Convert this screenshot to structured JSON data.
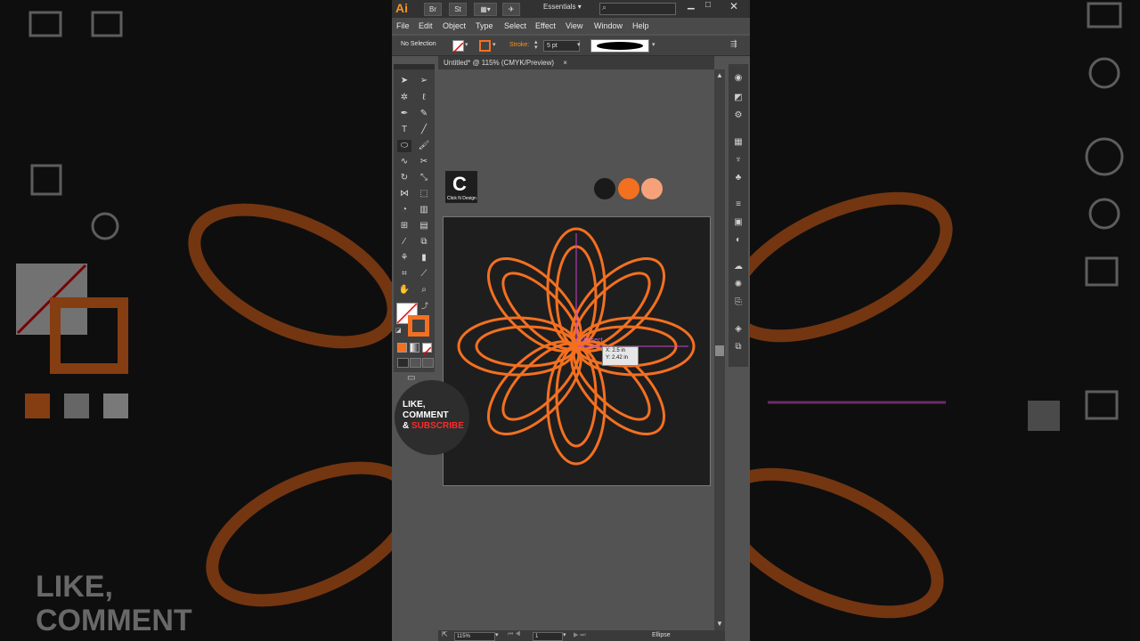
{
  "background": {
    "left_caption_line1": "LIKE,",
    "left_caption_line2": "COMMENT"
  },
  "titlebar": {
    "app_logo": "Ai",
    "br_label": "Br",
    "st_label": "St",
    "workspace": "Essentials",
    "search_placeholder": ""
  },
  "menu": {
    "items": [
      "File",
      "Edit",
      "Object",
      "Type",
      "Select",
      "Effect",
      "View",
      "Window",
      "Help"
    ]
  },
  "control_bar": {
    "selection": "No Selection",
    "stroke_label": "Stroke:",
    "stroke_weight": "5 pt"
  },
  "document_tab": {
    "title": "Untitled* @ 115% (CMYK/Preview)",
    "close": "×"
  },
  "logo": {
    "mark": "C",
    "caption": "Click N Design"
  },
  "swatches": {
    "colors": [
      "#1a1a1a",
      "#f37021",
      "#f5a27a"
    ]
  },
  "smart_guide": {
    "label": "intersect",
    "x": "X: 2.5 in",
    "y": "Y: 2.42 in"
  },
  "like_badge": {
    "line1": "LIKE,",
    "line2": "COMMENT",
    "line3_prefix": "& ",
    "line3_highlight": "SUBSCRIBE"
  },
  "status_bar": {
    "zoom": "115%",
    "page": "1",
    "tool": "Ellipse"
  },
  "colors": {
    "accent": "#f37021",
    "artboard": "#1e1e1e",
    "ui_bg": "#535353"
  }
}
